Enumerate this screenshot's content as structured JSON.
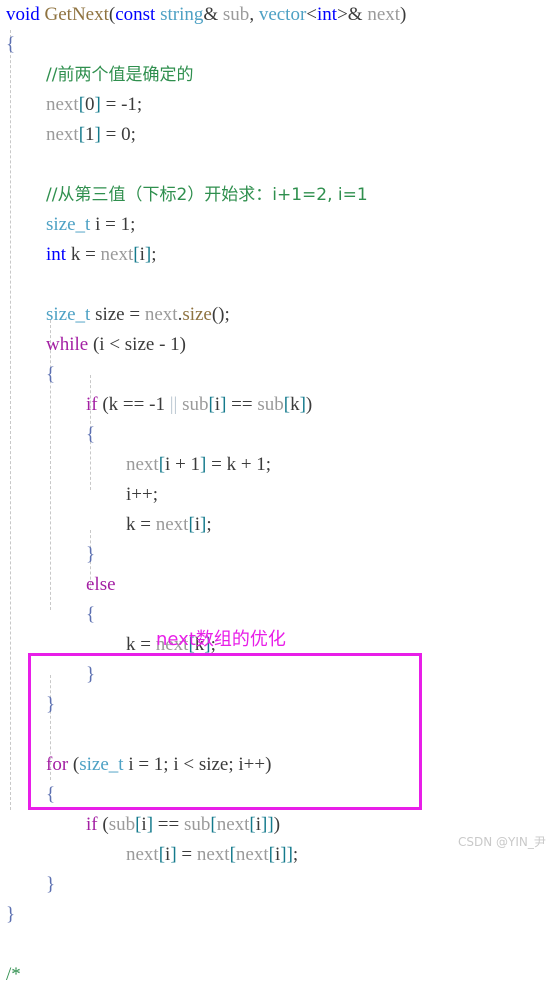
{
  "editor": {
    "language": "cpp",
    "background_color": "#ffffff",
    "font_size_px": 19,
    "line_height_px": 30,
    "colors": {
      "keyword": "#0000ff",
      "control_keyword": "#a31fa3",
      "type": "#4ea1c4",
      "function": "#8f7340",
      "identifier": "#9a9a9a",
      "plain": "#3b3b3b",
      "bracket": "#147a8c",
      "brace": "#5b6fb0",
      "comment": "#2f8f4e",
      "operator": "#b9c6d0",
      "annotation": "#e81ee8",
      "indent_guide": "#c8c8c8",
      "watermark": "#c9c9c9"
    }
  },
  "code": {
    "lines": [
      {
        "indent": 0,
        "tokens": [
          {
            "t": "void",
            "c": "kw"
          },
          {
            "t": " ",
            "c": "plain"
          },
          {
            "t": "GetNext",
            "c": "fn"
          },
          {
            "t": "(",
            "c": "plain"
          },
          {
            "t": "const",
            "c": "kw"
          },
          {
            "t": " ",
            "c": "plain"
          },
          {
            "t": "string",
            "c": "type"
          },
          {
            "t": "& ",
            "c": "plain"
          },
          {
            "t": "sub",
            "c": "ident"
          },
          {
            "t": ", ",
            "c": "plain"
          },
          {
            "t": "vector",
            "c": "type"
          },
          {
            "t": "<",
            "c": "plain"
          },
          {
            "t": "int",
            "c": "kw"
          },
          {
            "t": ">& ",
            "c": "plain"
          },
          {
            "t": "next",
            "c": "ident"
          },
          {
            "t": ")",
            "c": "plain"
          }
        ]
      },
      {
        "indent": 0,
        "tokens": [
          {
            "t": "{",
            "c": "brace"
          }
        ]
      },
      {
        "indent": 1,
        "tokens": [
          {
            "t": "//前两个值是确定的",
            "c": "cmt cmt-cn"
          }
        ]
      },
      {
        "indent": 1,
        "tokens": [
          {
            "t": "next",
            "c": "ident"
          },
          {
            "t": "[",
            "c": "brk"
          },
          {
            "t": "0",
            "c": "plain"
          },
          {
            "t": "]",
            "c": "brk"
          },
          {
            "t": " = -1;",
            "c": "plain"
          }
        ]
      },
      {
        "indent": 1,
        "tokens": [
          {
            "t": "next",
            "c": "ident"
          },
          {
            "t": "[",
            "c": "brk"
          },
          {
            "t": "1",
            "c": "plain"
          },
          {
            "t": "]",
            "c": "brk"
          },
          {
            "t": " = 0;",
            "c": "plain"
          }
        ]
      },
      {
        "indent": 1,
        "tokens": []
      },
      {
        "indent": 1,
        "tokens": [
          {
            "t": "//从第三值（下标2）开始求：i+1=2, i=1",
            "c": "cmt cmt-cn"
          }
        ]
      },
      {
        "indent": 1,
        "tokens": [
          {
            "t": "size_t",
            "c": "type"
          },
          {
            "t": " i = 1;",
            "c": "plain"
          }
        ]
      },
      {
        "indent": 1,
        "tokens": [
          {
            "t": "int",
            "c": "kw"
          },
          {
            "t": " k = ",
            "c": "plain"
          },
          {
            "t": "next",
            "c": "ident"
          },
          {
            "t": "[",
            "c": "brk"
          },
          {
            "t": "i",
            "c": "plain"
          },
          {
            "t": "]",
            "c": "brk"
          },
          {
            "t": ";",
            "c": "plain"
          }
        ]
      },
      {
        "indent": 1,
        "tokens": []
      },
      {
        "indent": 1,
        "tokens": [
          {
            "t": "size_t",
            "c": "type"
          },
          {
            "t": " size = ",
            "c": "plain"
          },
          {
            "t": "next",
            "c": "ident"
          },
          {
            "t": ".",
            "c": "plain"
          },
          {
            "t": "size",
            "c": "fn"
          },
          {
            "t": "();",
            "c": "plain"
          }
        ]
      },
      {
        "indent": 1,
        "tokens": [
          {
            "t": "while",
            "c": "kwctl"
          },
          {
            "t": " (i < size - 1)",
            "c": "plain"
          }
        ]
      },
      {
        "indent": 1,
        "tokens": [
          {
            "t": "{",
            "c": "brace"
          }
        ]
      },
      {
        "indent": 2,
        "tokens": [
          {
            "t": "if",
            "c": "kwctl"
          },
          {
            "t": " (k == -1 ",
            "c": "plain"
          },
          {
            "t": "||",
            "c": "op"
          },
          {
            "t": " ",
            "c": "plain"
          },
          {
            "t": "sub",
            "c": "ident"
          },
          {
            "t": "[",
            "c": "brk"
          },
          {
            "t": "i",
            "c": "plain"
          },
          {
            "t": "]",
            "c": "brk"
          },
          {
            "t": " == ",
            "c": "plain"
          },
          {
            "t": "sub",
            "c": "ident"
          },
          {
            "t": "[",
            "c": "brk"
          },
          {
            "t": "k",
            "c": "plain"
          },
          {
            "t": "]",
            "c": "brk"
          },
          {
            "t": ")",
            "c": "plain"
          }
        ]
      },
      {
        "indent": 2,
        "tokens": [
          {
            "t": "{",
            "c": "brace"
          }
        ]
      },
      {
        "indent": 3,
        "tokens": [
          {
            "t": "next",
            "c": "ident"
          },
          {
            "t": "[",
            "c": "brk"
          },
          {
            "t": "i + 1",
            "c": "plain"
          },
          {
            "t": "]",
            "c": "brk"
          },
          {
            "t": " = k + 1;",
            "c": "plain"
          }
        ]
      },
      {
        "indent": 3,
        "tokens": [
          {
            "t": "i++;",
            "c": "plain"
          }
        ]
      },
      {
        "indent": 3,
        "tokens": [
          {
            "t": "k = ",
            "c": "plain"
          },
          {
            "t": "next",
            "c": "ident"
          },
          {
            "t": "[",
            "c": "brk"
          },
          {
            "t": "i",
            "c": "plain"
          },
          {
            "t": "]",
            "c": "brk"
          },
          {
            "t": ";",
            "c": "plain"
          }
        ]
      },
      {
        "indent": 2,
        "tokens": [
          {
            "t": "}",
            "c": "brace"
          }
        ]
      },
      {
        "indent": 2,
        "tokens": [
          {
            "t": "else",
            "c": "kwctl"
          }
        ]
      },
      {
        "indent": 2,
        "tokens": [
          {
            "t": "{",
            "c": "brace"
          }
        ]
      },
      {
        "indent": 3,
        "tokens": [
          {
            "t": "k = ",
            "c": "plain"
          },
          {
            "t": "next",
            "c": "ident"
          },
          {
            "t": "[",
            "c": "brk"
          },
          {
            "t": "k",
            "c": "plain"
          },
          {
            "t": "]",
            "c": "brk"
          },
          {
            "t": ";",
            "c": "plain"
          }
        ]
      },
      {
        "indent": 2,
        "tokens": [
          {
            "t": "}",
            "c": "brace"
          }
        ]
      },
      {
        "indent": 1,
        "tokens": [
          {
            "t": "}",
            "c": "brace"
          }
        ]
      },
      {
        "indent": 1,
        "tokens": []
      },
      {
        "indent": 1,
        "tokens": [
          {
            "t": "for",
            "c": "kwctl"
          },
          {
            "t": " (",
            "c": "plain"
          },
          {
            "t": "size_t",
            "c": "type"
          },
          {
            "t": " i = 1; i < size; i++)",
            "c": "plain"
          }
        ]
      },
      {
        "indent": 1,
        "tokens": [
          {
            "t": "{",
            "c": "brace"
          }
        ]
      },
      {
        "indent": 2,
        "tokens": [
          {
            "t": "if",
            "c": "kwctl"
          },
          {
            "t": " (",
            "c": "plain"
          },
          {
            "t": "sub",
            "c": "ident"
          },
          {
            "t": "[",
            "c": "brk"
          },
          {
            "t": "i",
            "c": "plain"
          },
          {
            "t": "]",
            "c": "brk"
          },
          {
            "t": " == ",
            "c": "plain"
          },
          {
            "t": "sub",
            "c": "ident"
          },
          {
            "t": "[",
            "c": "brk"
          },
          {
            "t": "next",
            "c": "ident"
          },
          {
            "t": "[",
            "c": "brk"
          },
          {
            "t": "i",
            "c": "plain"
          },
          {
            "t": "]",
            "c": "brk"
          },
          {
            "t": "]",
            "c": "brk"
          },
          {
            "t": ")",
            "c": "plain"
          }
        ]
      },
      {
        "indent": 3,
        "tokens": [
          {
            "t": "next",
            "c": "ident"
          },
          {
            "t": "[",
            "c": "brk"
          },
          {
            "t": "i",
            "c": "plain"
          },
          {
            "t": "]",
            "c": "brk"
          },
          {
            "t": " = ",
            "c": "plain"
          },
          {
            "t": "next",
            "c": "ident"
          },
          {
            "t": "[",
            "c": "brk"
          },
          {
            "t": "next",
            "c": "ident"
          },
          {
            "t": "[",
            "c": "brk"
          },
          {
            "t": "i",
            "c": "plain"
          },
          {
            "t": "]",
            "c": "brk"
          },
          {
            "t": "]",
            "c": "brk"
          },
          {
            "t": ";",
            "c": "plain"
          }
        ]
      },
      {
        "indent": 1,
        "tokens": [
          {
            "t": "}",
            "c": "brace"
          }
        ]
      },
      {
        "indent": 0,
        "tokens": [
          {
            "t": "}",
            "c": "brace"
          }
        ]
      },
      {
        "indent": 0,
        "tokens": []
      },
      {
        "indent": 0,
        "tokens": [
          {
            "t": "/*",
            "c": "cmt"
          }
        ]
      }
    ]
  },
  "annotation": {
    "label": "next数组的优化",
    "box_color": "#e81ee8"
  },
  "watermark": {
    "text": "CSDN @YIN_尹"
  }
}
